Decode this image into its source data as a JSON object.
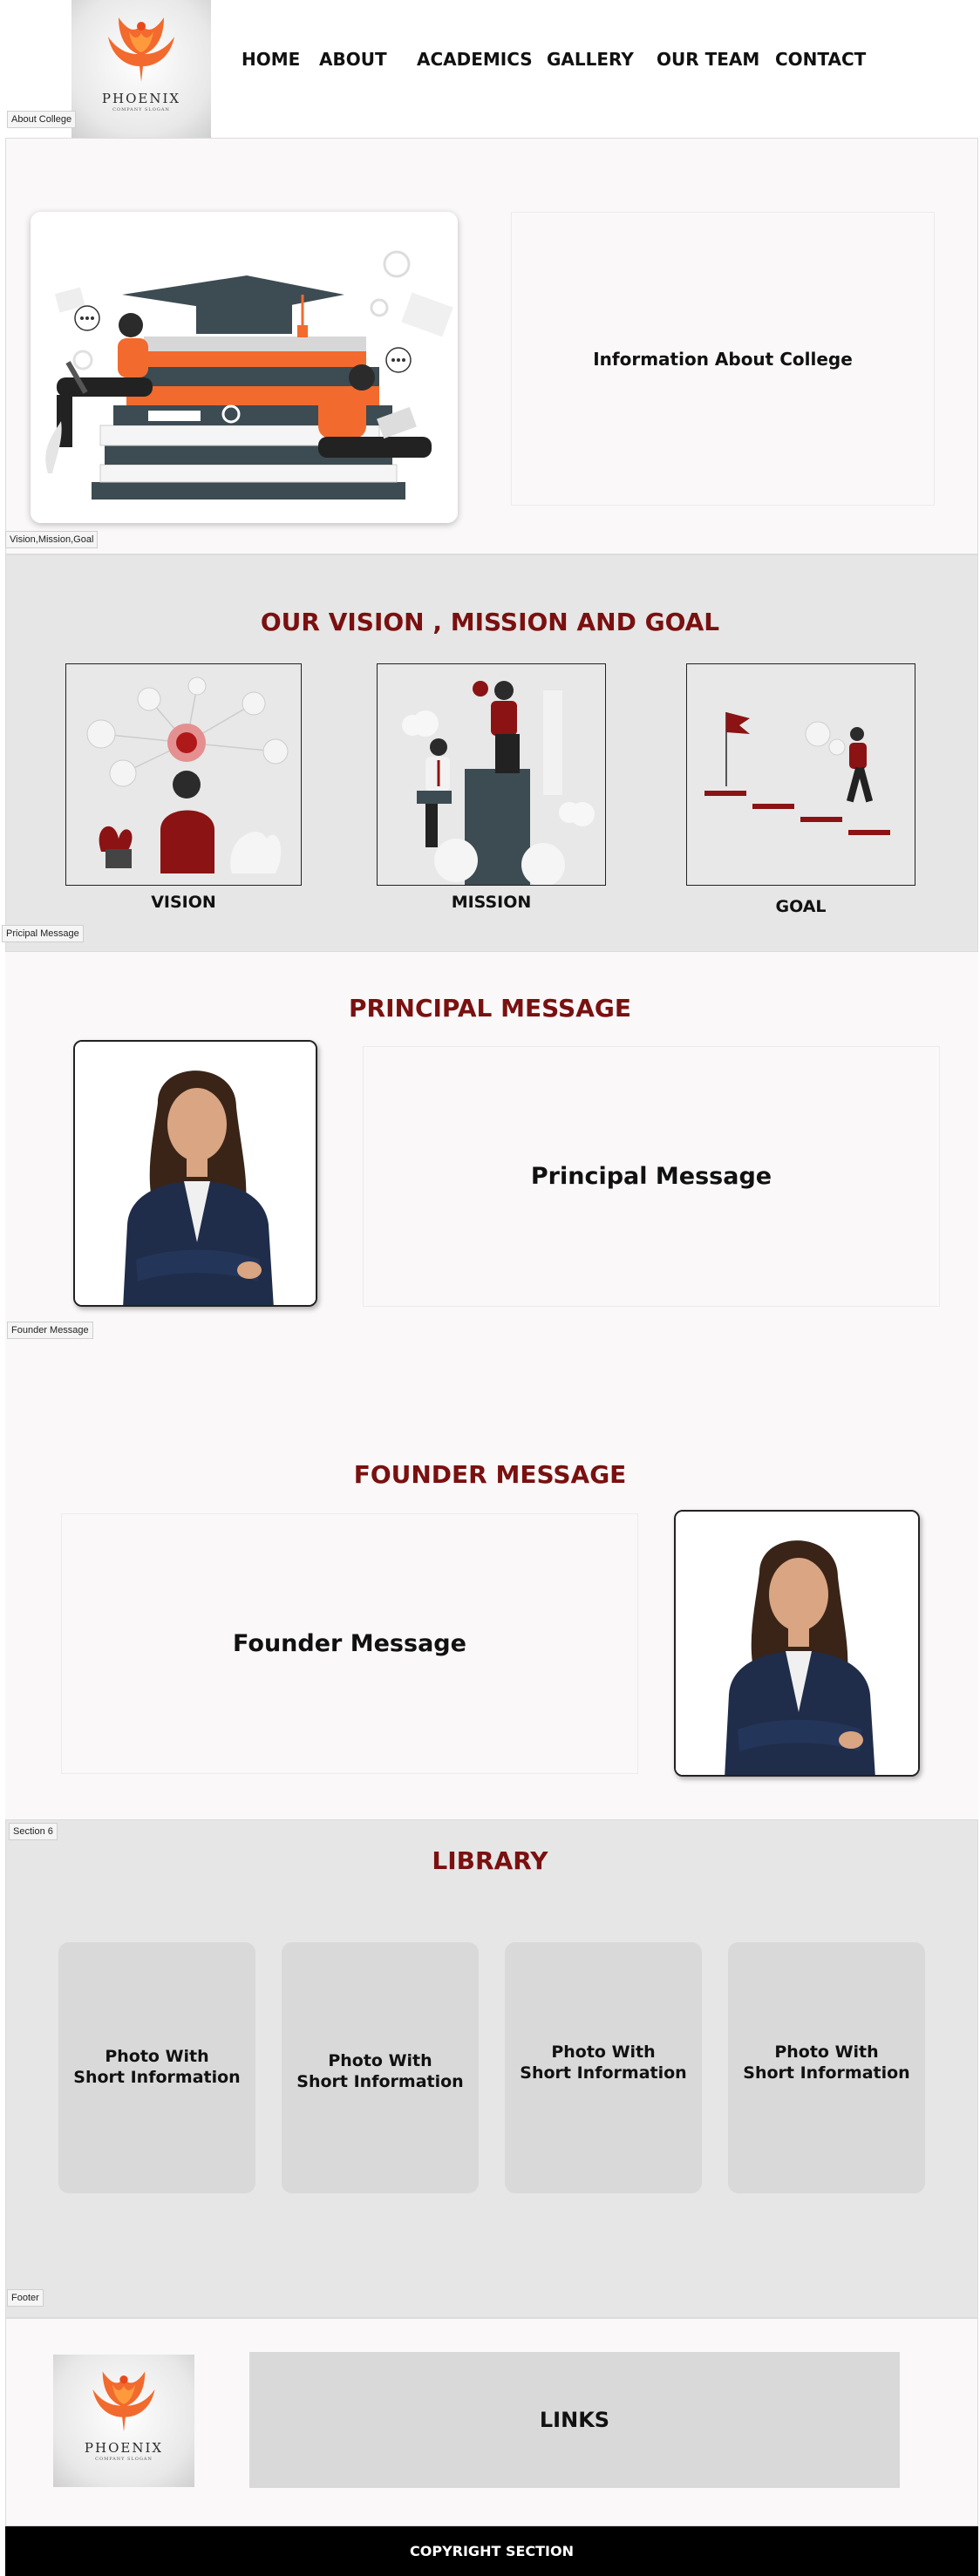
{
  "header": {
    "logo": {
      "title": "PHOENIX",
      "subtitle": "COMPANY SLOGAN"
    },
    "nav": [
      "HOME",
      "ABOUT",
      "ACADEMICS",
      "GALLERY",
      "OUR TEAM",
      "CONTACT"
    ]
  },
  "tags": {
    "about": "About College",
    "vision": "Vision,Mission,Goal",
    "principal": "Pricipal Message",
    "founder": "Founder Message",
    "section6": "Section 6",
    "footer": "Footer"
  },
  "about": {
    "info": "Information About College"
  },
  "vision": {
    "title": "OUR VISION , MISSION AND GOAL",
    "items": [
      "VISION",
      "MISSION",
      "GOAL"
    ]
  },
  "principal": {
    "title": "PRINCIPAL MESSAGE",
    "message": "Principal Message"
  },
  "founder": {
    "title": "FOUNDER MESSAGE",
    "message": "Founder Message"
  },
  "library": {
    "title": "LIBRARY",
    "cards": [
      "Photo With\nShort Information",
      "Photo With\nShort Information",
      "Photo With\nShort Information",
      "Photo With\nShort Information"
    ]
  },
  "footer": {
    "links": "LINKS",
    "copyright": "COPYRIGHT SECTION"
  },
  "colors": {
    "accent": "#7a1010",
    "orange": "#f26a2e",
    "dark_slate": "#3d4b52"
  }
}
